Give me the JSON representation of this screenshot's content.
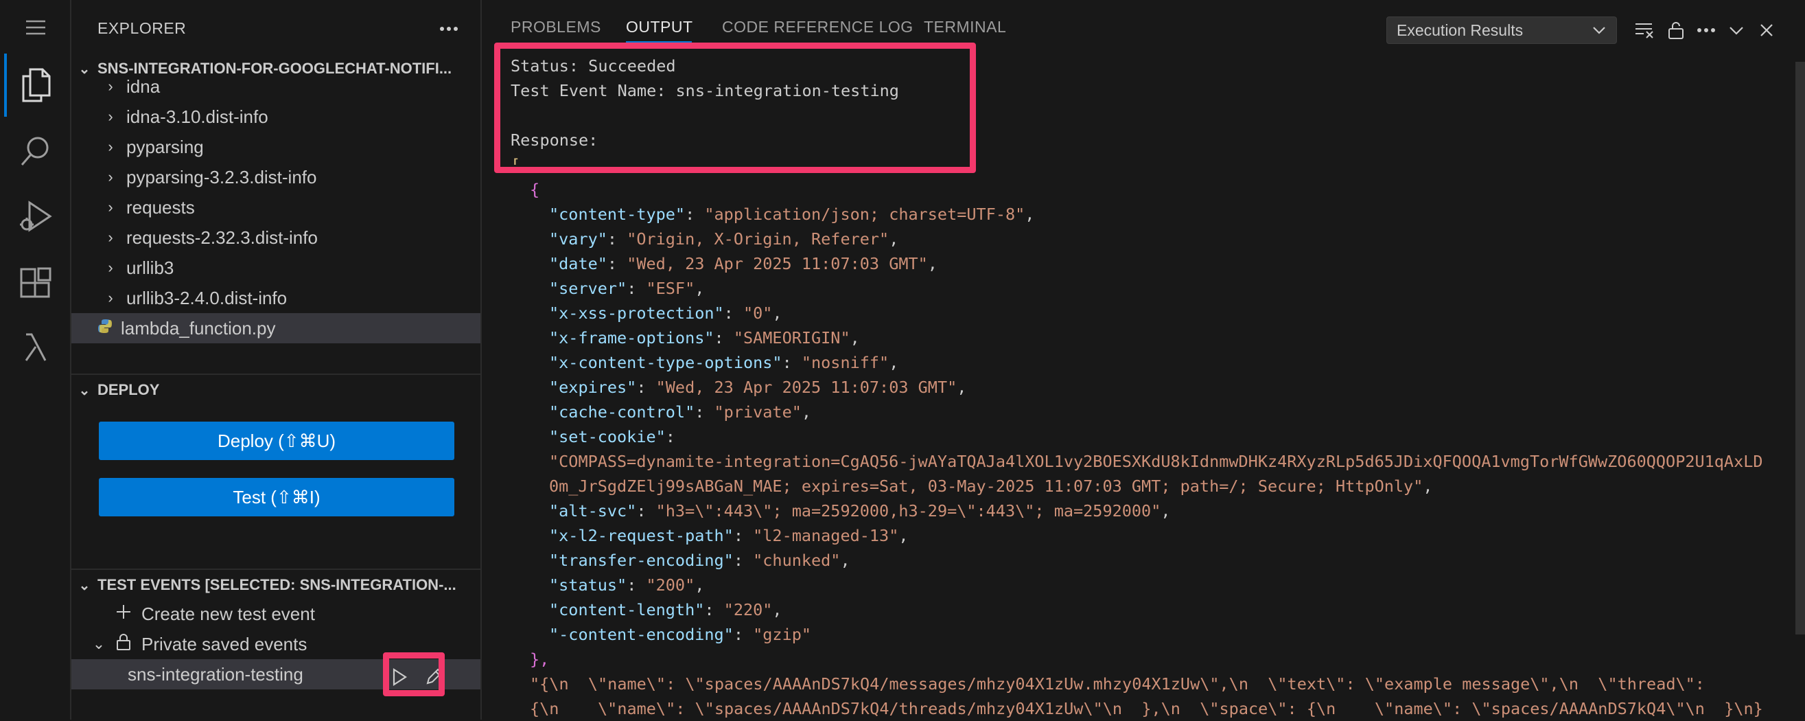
{
  "explorer": {
    "title": "EXPLORER",
    "more_icon": "ellipsis-icon",
    "project": "SNS-INTEGRATION-FOR-GOOGLECHAT-NOTIFI...",
    "partial_item": "idna",
    "items": [
      {
        "label": "idna-3.10.dist-info",
        "type": "folder"
      },
      {
        "label": "pyparsing",
        "type": "folder"
      },
      {
        "label": "pyparsing-3.2.3.dist-info",
        "type": "folder"
      },
      {
        "label": "requests",
        "type": "folder"
      },
      {
        "label": "requests-2.32.3.dist-info",
        "type": "folder"
      },
      {
        "label": "urllib3",
        "type": "folder"
      },
      {
        "label": "urllib3-2.4.0.dist-info",
        "type": "folder"
      },
      {
        "label": "lambda_function.py",
        "type": "python-file",
        "selected": true
      }
    ]
  },
  "deploy": {
    "header": "DEPLOY",
    "deploy_button": "Deploy (⇧⌘U)",
    "test_button": "Test (⇧⌘I)"
  },
  "test_events": {
    "header": "TEST EVENTS [SELECTED: SNS-INTEGRATION-...",
    "create_label": "Create new test event",
    "private_label": "Private saved events",
    "event_name": "sns-integration-testing"
  },
  "panel": {
    "tabs": [
      "PROBLEMS",
      "OUTPUT",
      "CODE REFERENCE LOG",
      "TERMINAL"
    ],
    "active_tab": "OUTPUT",
    "dropdown_value": "Execution Results"
  },
  "output": {
    "status_line": "Status: Succeeded",
    "event_line": "Test Event Name: sns-integration-testing",
    "response_label": "Response:",
    "open_bracket": "[",
    "open_brace": "{",
    "headers": [
      {
        "key": "\"content-type\"",
        "value": "\"application/json; charset=UTF-8\"",
        "sep": ","
      },
      {
        "key": "\"vary\"",
        "value": "\"Origin, X-Origin, Referer\"",
        "sep": ","
      },
      {
        "key": "\"date\"",
        "value": "\"Wed, 23 Apr 2025 11:07:03 GMT\"",
        "sep": ","
      },
      {
        "key": "\"server\"",
        "value": "\"ESF\"",
        "sep": ","
      },
      {
        "key": "\"x-xss-protection\"",
        "value": "\"0\"",
        "sep": ","
      },
      {
        "key": "\"x-frame-options\"",
        "value": "\"SAMEORIGIN\"",
        "sep": ","
      },
      {
        "key": "\"x-content-type-options\"",
        "value": "\"nosniff\"",
        "sep": ","
      },
      {
        "key": "\"expires\"",
        "value": "\"Wed, 23 Apr 2025 11:07:03 GMT\"",
        "sep": ","
      },
      {
        "key": "\"cache-control\"",
        "value": "\"private\"",
        "sep": ","
      }
    ],
    "set_cookie_key": "\"set-cookie\"",
    "set_cookie_line1": "\"COMPASS=dynamite-integration=CgAQ56-jwAYaTQAJa4lXOL1vy2BOESXKdU8kIdnmwDHKz4RXyzRLp5d65JDixQFQOQA1vmgTorWfGWwZO60QQOP2U1qAxLD",
    "set_cookie_line2": "0m_JrSgdZElj99sABGaN_MAE; expires=Sat, 03-May-2025 11:07:03 GMT; path=/; Secure; HttpOnly\"",
    "headers2": [
      {
        "key": "\"alt-svc\"",
        "value": "\"h3=\\\":443\\\"; ma=2592000,h3-29=\\\":443\\\"; ma=2592000\"",
        "sep": ","
      },
      {
        "key": "\"x-l2-request-path\"",
        "value": "\"l2-managed-13\"",
        "sep": ","
      },
      {
        "key": "\"transfer-encoding\"",
        "value": "\"chunked\"",
        "sep": ","
      },
      {
        "key": "\"status\"",
        "value": "\"200\"",
        "sep": ","
      },
      {
        "key": "\"content-length\"",
        "value": "\"220\"",
        "sep": ","
      },
      {
        "key": "\"-content-encoding\"",
        "value": "\"gzip\"",
        "sep": ""
      }
    ],
    "close_brace": "},",
    "body_line1": "\"{\\n  \\\"name\\\": \\\"spaces/AAAAnDS7kQ4/messages/mhzy04X1zUw.mhzy04X1zUw\\\",\\n  \\\"text\\\": \\\"example message\\\",\\n  \\\"thread\\\":",
    "body_line2": "{\\n    \\\"name\\\": \\\"spaces/AAAAnDS7kQ4/threads/mhzy04X1zUw\\\"\\n  },\\n  \\\"space\\\": {\\n    \\\"name\\\": \\\"spaces/AAAAnDS7kQ4\\\"\\n  }\\n}"
  },
  "colors": {
    "accent": "#0078d4",
    "highlight": "#f2386b",
    "json_key": "#9cdcfe",
    "json_string": "#ce9178"
  }
}
